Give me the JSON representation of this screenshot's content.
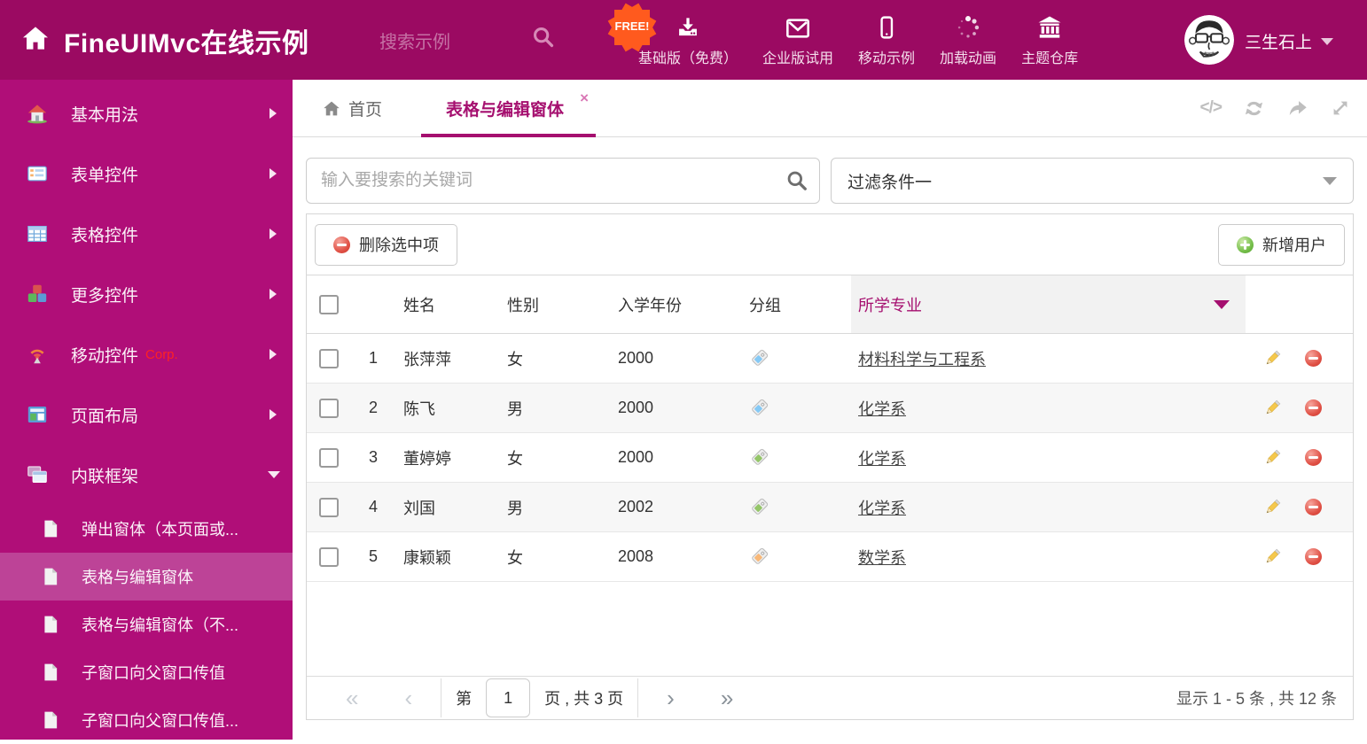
{
  "colors": {
    "header_bg": "#9B0A62",
    "sidebar_bg": "#B00E78",
    "sidebar_active_bg": "#BD4397",
    "accent_magenta": "#A50F6F",
    "free_badge_orange": "#FF5A1E",
    "corp_red": "#FF2222",
    "tag_blue": "#85C9F5",
    "tag_green": "#94C569",
    "tag_orange": "#F8B878"
  },
  "header": {
    "title": "FineUIMvc在线示例",
    "search_placeholder": "搜索示例",
    "free_badge": "FREE!",
    "nav": [
      {
        "label": "基础版（免费）",
        "icon": "download-icon"
      },
      {
        "label": "企业版试用",
        "icon": "envelope-icon"
      },
      {
        "label": "移动示例",
        "icon": "mobile-icon"
      },
      {
        "label": "加载动画",
        "icon": "spinner-icon"
      },
      {
        "label": "主题仓库",
        "icon": "bank-icon"
      }
    ],
    "user": {
      "name": "三生石上"
    }
  },
  "sidebar": {
    "items": [
      {
        "label": "基本用法",
        "icon": "house-icon"
      },
      {
        "label": "表单控件",
        "icon": "form-icon"
      },
      {
        "label": "表格控件",
        "icon": "grid-icon"
      },
      {
        "label": "更多控件",
        "icon": "cubes-icon"
      },
      {
        "label": "移动控件",
        "badge": "Corp.",
        "icon": "antenna-icon"
      },
      {
        "label": "页面布局",
        "icon": "layout-icon"
      },
      {
        "label": "内联框架",
        "icon": "frames-icon",
        "expanded": true
      }
    ],
    "subitems": [
      {
        "label": "弹出窗体（本页面或..."
      },
      {
        "label": "表格与编辑窗体",
        "active": true
      },
      {
        "label": "表格与编辑窗体（不..."
      },
      {
        "label": "子窗口向父窗口传值"
      },
      {
        "label": "子窗口向父窗口传值..."
      }
    ]
  },
  "tabs": {
    "home_tab": "首页",
    "active_tab": "表格与编辑窗体"
  },
  "filter_bar": {
    "search_placeholder": "输入要搜索的关键词",
    "filter_value": "过滤条件一"
  },
  "grid": {
    "delete_button": "删除选中项",
    "add_button": "新增用户",
    "columns": {
      "name": "姓名",
      "gender": "性别",
      "year": "入学年份",
      "group": "分组",
      "major": "所学专业"
    },
    "rows": [
      {
        "index": "1",
        "name": "张萍萍",
        "gender": "女",
        "year": "2000",
        "tag_color": "blue",
        "major": "材料科学与工程系"
      },
      {
        "index": "2",
        "name": "陈飞",
        "gender": "男",
        "year": "2000",
        "tag_color": "blue",
        "major": "化学系"
      },
      {
        "index": "3",
        "name": "董婷婷",
        "gender": "女",
        "year": "2000",
        "tag_color": "green",
        "major": "化学系"
      },
      {
        "index": "4",
        "name": "刘国",
        "gender": "男",
        "year": "2002",
        "tag_color": "green",
        "major": "化学系"
      },
      {
        "index": "5",
        "name": "康颖颖",
        "gender": "女",
        "year": "2008",
        "tag_color": "orange",
        "major": "数学系"
      }
    ]
  },
  "pagination": {
    "page_label_prefix": "第",
    "current_page": "1",
    "page_label_suffix": "页 , 共 3 页",
    "summary": "显示 1 - 5 条 , 共 12 条"
  }
}
